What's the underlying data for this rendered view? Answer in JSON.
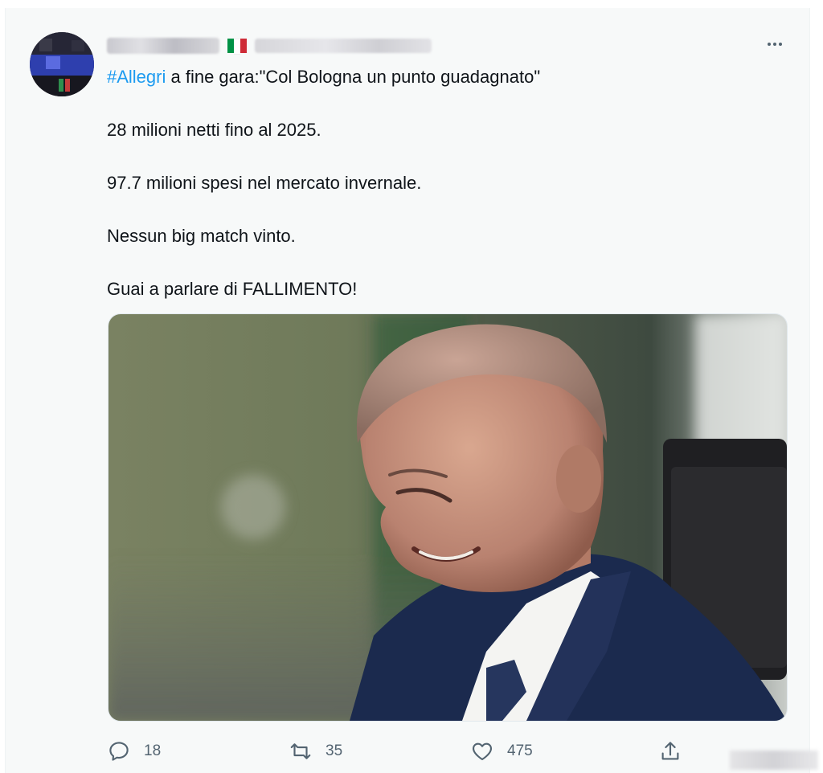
{
  "tweet": {
    "author": {
      "avatar_icon": "avatar-icon",
      "flag_colors": [
        "#009246",
        "#ffffff",
        "#ce2b37"
      ]
    },
    "text": {
      "hashtag": "#Allegri",
      "line1_rest": " a fine gara:\"Col Bologna un punto guadagnato\"",
      "line2": "28 milioni netti fino al 2025.",
      "line3": "97.7 milioni spesi nel mercato invernale.",
      "line4": "Nessun big match vinto.",
      "line5": "Guai a parlare di FALLIMENTO!"
    },
    "actions": {
      "reply": {
        "icon": "reply-icon",
        "count": "18"
      },
      "retweet": {
        "icon": "retweet-icon",
        "count": "35"
      },
      "like": {
        "icon": "like-icon",
        "count": "475"
      },
      "share": {
        "icon": "share-icon"
      }
    },
    "colors": {
      "accent": "#1d9bf0",
      "secondary_text": "#536471",
      "background": "#f7f9f9"
    }
  }
}
